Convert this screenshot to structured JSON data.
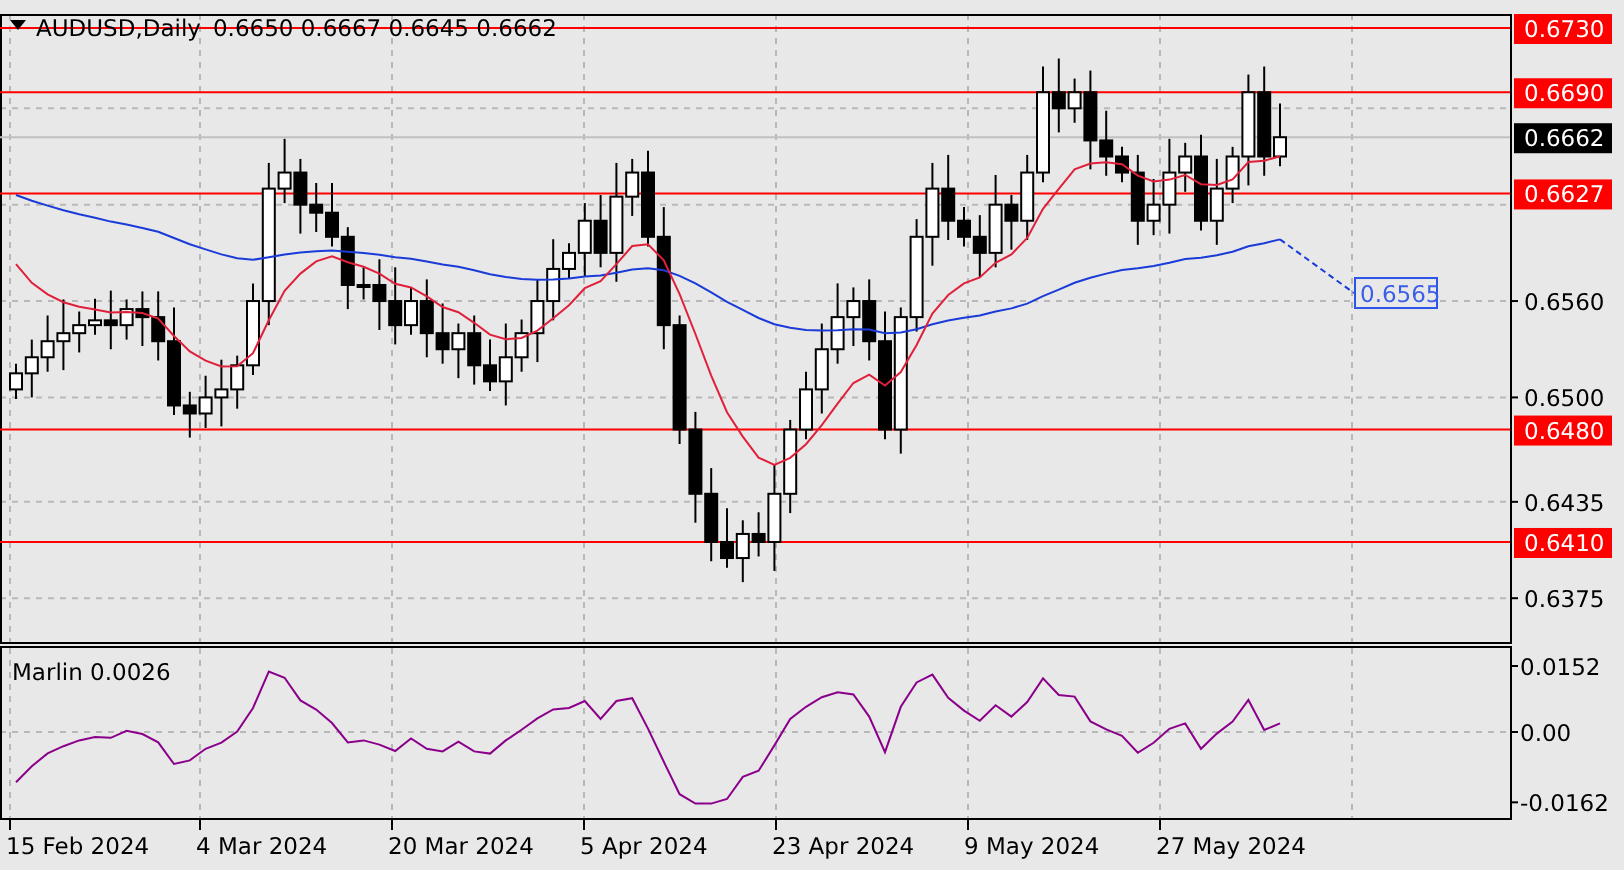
{
  "title": {
    "symbol": "AUDUSD,Daily",
    "ohlc": [
      "0.6650",
      "0.6667",
      "0.6645",
      "0.6662"
    ]
  },
  "price_axis": {
    "ticks": [
      "0.6560",
      "0.6500",
      "0.6435",
      "0.6375"
    ]
  },
  "levels": [
    {
      "label": "0.6730"
    },
    {
      "label": "0.6690"
    },
    {
      "label": "0.6627"
    },
    {
      "label": "0.6480"
    },
    {
      "label": "0.6410"
    }
  ],
  "current_price": "0.6662",
  "moving_average_label": "0.6565",
  "indicator": {
    "name": "Marlin",
    "value": "0.0026",
    "ticks": [
      "0.0152",
      "0.00",
      "-0.0162"
    ]
  },
  "dates": [
    "15 Feb 2024",
    "4 Mar 2024",
    "20 Mar 2024",
    "5 Apr 2024",
    "23 Apr 2024",
    "9 May 2024",
    "27 May 2024"
  ]
}
